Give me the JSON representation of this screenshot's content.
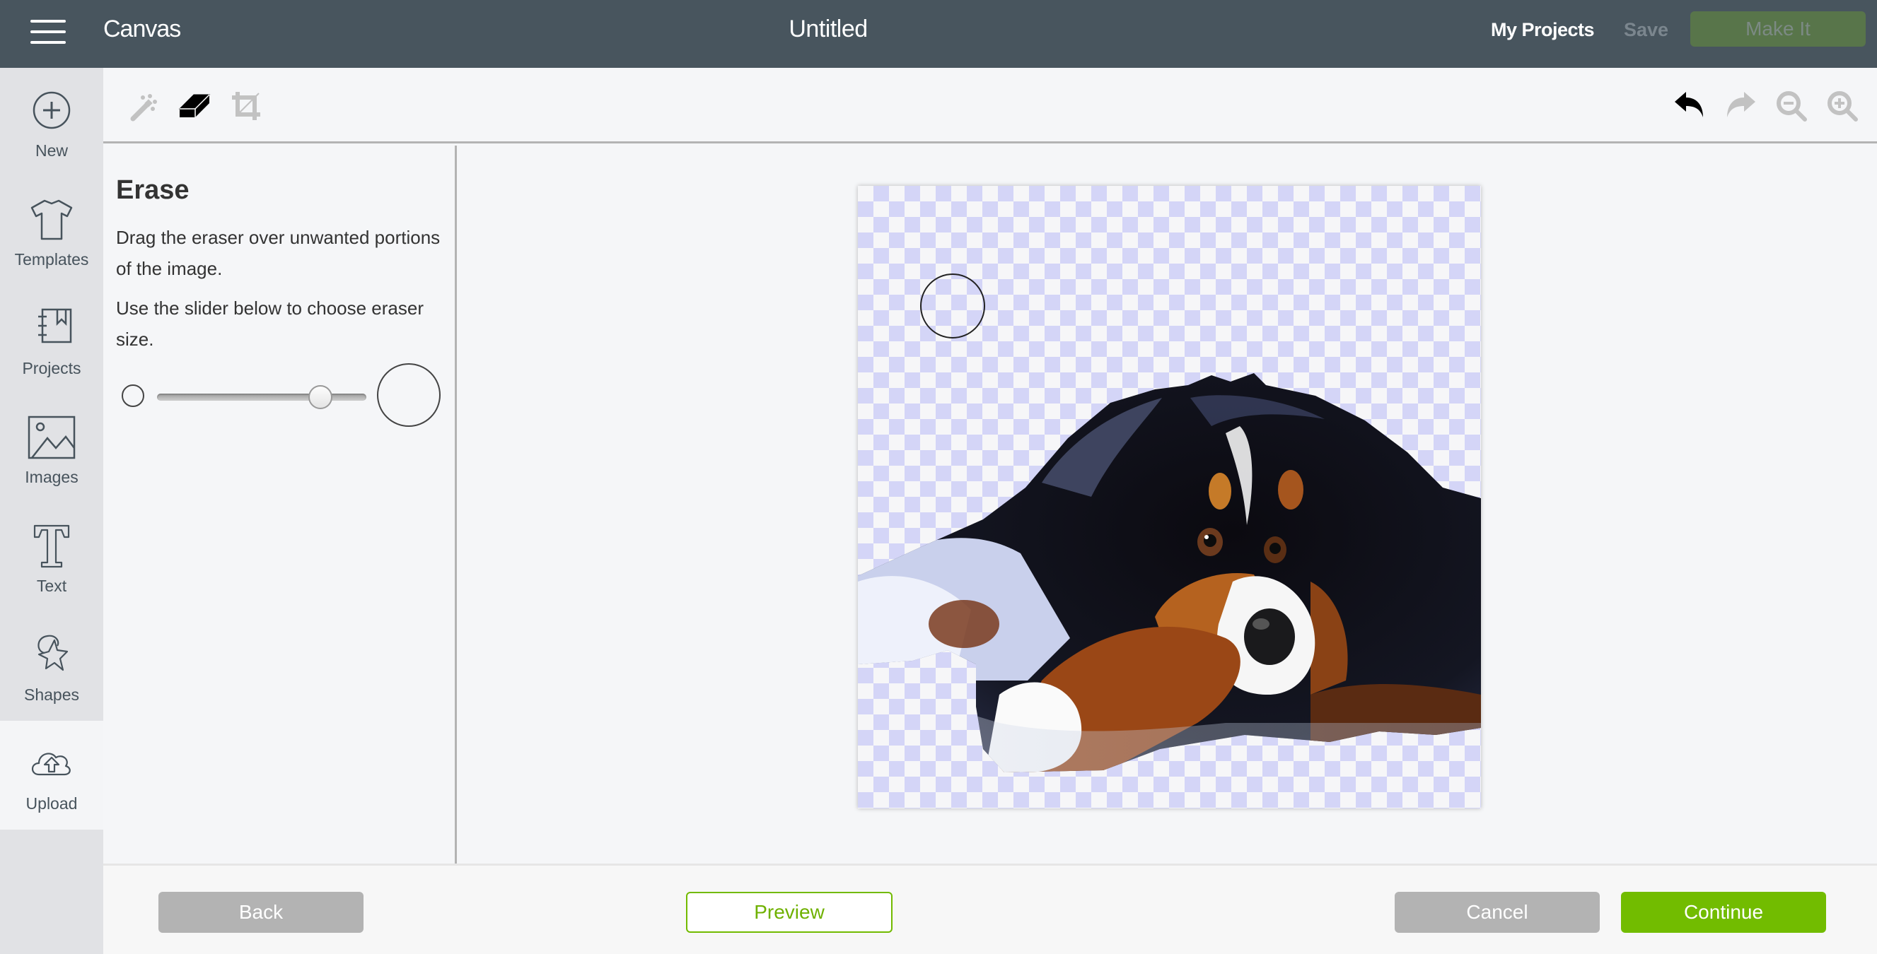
{
  "header": {
    "menu_icon": "hamburger-menu-icon",
    "app_title": "Canvas",
    "document_title": "Untitled",
    "my_projects": "My Projects",
    "save": "Save",
    "make_it": "Make It"
  },
  "sidebar": {
    "active": "Upload",
    "items": [
      {
        "label": "New",
        "icon": "plus-circle-icon"
      },
      {
        "label": "Templates",
        "icon": "tshirt-icon"
      },
      {
        "label": "Projects",
        "icon": "notebook-icon"
      },
      {
        "label": "Images",
        "icon": "image-icon"
      },
      {
        "label": "Text",
        "icon": "text-icon"
      },
      {
        "label": "Shapes",
        "icon": "shapes-icon"
      },
      {
        "label": "Upload",
        "icon": "cloud-upload-icon"
      }
    ]
  },
  "toolbar": {
    "left_tools": [
      {
        "name": "magic-wand",
        "state": "inactive"
      },
      {
        "name": "eraser",
        "state": "active"
      },
      {
        "name": "crop",
        "state": "inactive"
      }
    ],
    "right_tools": [
      {
        "name": "undo",
        "state": "enabled"
      },
      {
        "name": "redo",
        "state": "disabled"
      },
      {
        "name": "zoom-out",
        "state": "disabled"
      },
      {
        "name": "zoom-in",
        "state": "disabled"
      }
    ]
  },
  "panel": {
    "title": "Erase",
    "instruction_1": "Drag the eraser over unwanted portions of the image.",
    "instruction_2": "Use the slider below to choose eraser size.",
    "eraser_size_fraction": 0.78
  },
  "canvas": {
    "image_subject": "Bernese mountain dog lying down",
    "background": "transparency checkerboard",
    "colors": {
      "checker_dark": "#d4d5f7",
      "checker_light": "#f6f6f8"
    }
  },
  "footer": {
    "back": "Back",
    "preview": "Preview",
    "cancel": "Cancel",
    "continue": "Continue"
  },
  "colors": {
    "header_bg": "#48555e",
    "accent_green": "#72bc00",
    "make_it_bg": "#58754a",
    "button_gray": "#b3b3b3"
  }
}
